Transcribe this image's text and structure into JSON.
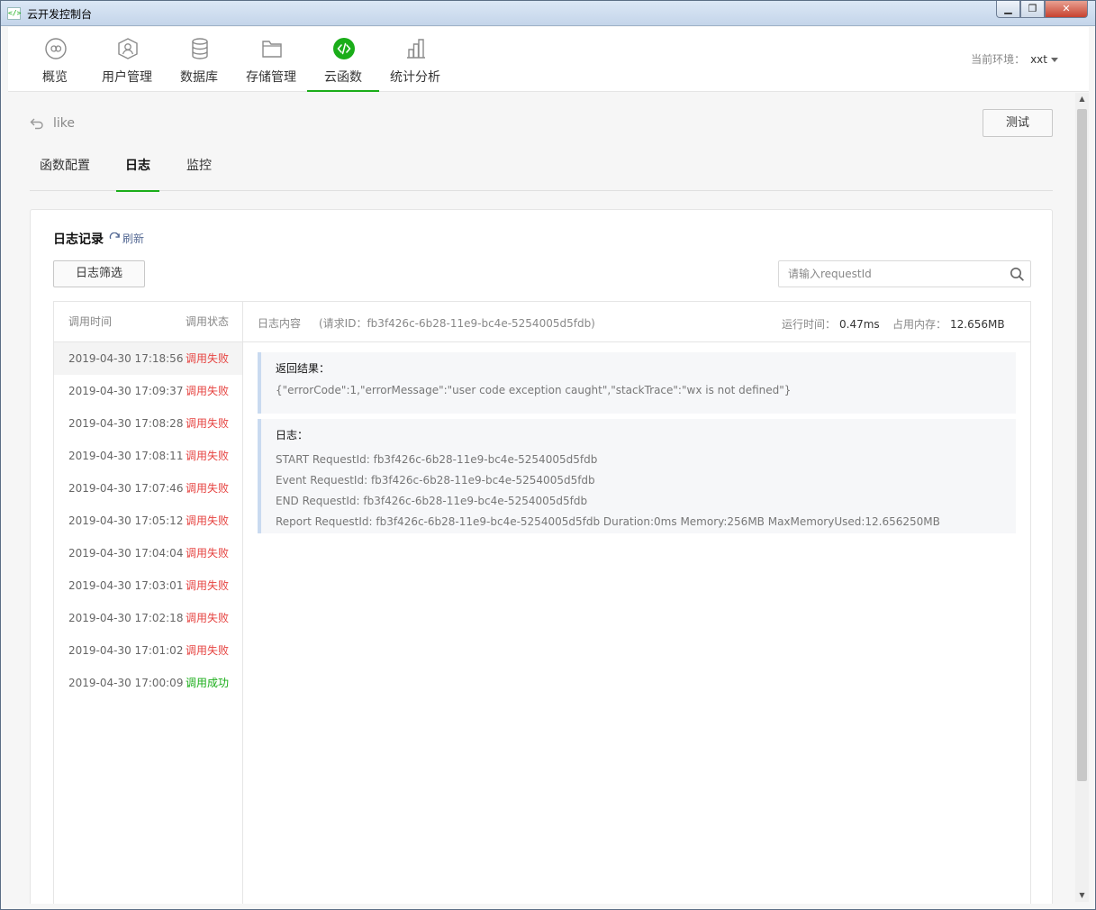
{
  "window": {
    "title": "云开发控制台",
    "app_icon": "</>",
    "controls": {
      "minimize": "▁",
      "maximize": "❐",
      "close": "✕"
    }
  },
  "topnav": {
    "items": [
      {
        "label": "概览",
        "icon": "infinity-icon"
      },
      {
        "label": "用户管理",
        "icon": "user-icon"
      },
      {
        "label": "数据库",
        "icon": "database-icon"
      },
      {
        "label": "存储管理",
        "icon": "folder-icon"
      },
      {
        "label": "云函数",
        "icon": "code-icon"
      },
      {
        "label": "统计分析",
        "icon": "bar-chart-icon"
      }
    ],
    "active_index": 4,
    "env_label": "当前环境：",
    "env_value": "xxt"
  },
  "page": {
    "back_label": "like",
    "test_button": "测试",
    "tabs": [
      "函数配置",
      "日志",
      "监控"
    ],
    "active_tab": 1
  },
  "logs": {
    "title": "日志记录",
    "refresh_label": "刷新",
    "filter_button": "日志筛选",
    "search_placeholder": "请输入requestId",
    "columns": {
      "time": "调用时间",
      "status": "调用状态"
    },
    "rows": [
      {
        "time": "2019-04-30 17:18:56",
        "status": "调用失败",
        "ok": false
      },
      {
        "time": "2019-04-30 17:09:37",
        "status": "调用失败",
        "ok": false
      },
      {
        "time": "2019-04-30 17:08:28",
        "status": "调用失败",
        "ok": false
      },
      {
        "time": "2019-04-30 17:08:11",
        "status": "调用失败",
        "ok": false
      },
      {
        "time": "2019-04-30 17:07:46",
        "status": "调用失败",
        "ok": false
      },
      {
        "time": "2019-04-30 17:05:12",
        "status": "调用失败",
        "ok": false
      },
      {
        "time": "2019-04-30 17:04:04",
        "status": "调用失败",
        "ok": false
      },
      {
        "time": "2019-04-30 17:03:01",
        "status": "调用失败",
        "ok": false
      },
      {
        "time": "2019-04-30 17:02:18",
        "status": "调用失败",
        "ok": false
      },
      {
        "time": "2019-04-30 17:01:02",
        "status": "调用失败",
        "ok": false
      },
      {
        "time": "2019-04-30 17:00:09",
        "status": "调用成功",
        "ok": true
      }
    ],
    "selected_index": 0,
    "detail": {
      "content_label": "日志内容",
      "request_id_text": "(请求ID：fb3f426c-6b28-11e9-bc4e-5254005d5fdb)",
      "runtime_label": "运行时间：",
      "runtime_value": "0.47ms",
      "memory_label": "占用内存：",
      "memory_value": "12.656MB",
      "result_title": "返回结果：",
      "result_text": "{\"errorCode\":1,\"errorMessage\":\"user code exception caught\",\"stackTrace\":\"wx is not defined\"}",
      "log_title": "日志：",
      "log_lines": [
        "START RequestId: fb3f426c-6b28-11e9-bc4e-5254005d5fdb",
        "Event RequestId: fb3f426c-6b28-11e9-bc4e-5254005d5fdb",
        "END RequestId: fb3f426c-6b28-11e9-bc4e-5254005d5fdb",
        "Report RequestId: fb3f426c-6b28-11e9-bc4e-5254005d5fdb Duration:0ms Memory:256MB MaxMemoryUsed:12.656250MB"
      ]
    }
  },
  "colors": {
    "accent_green": "#1aad19",
    "fail_red": "#e64340",
    "link_blue": "#576b95"
  }
}
